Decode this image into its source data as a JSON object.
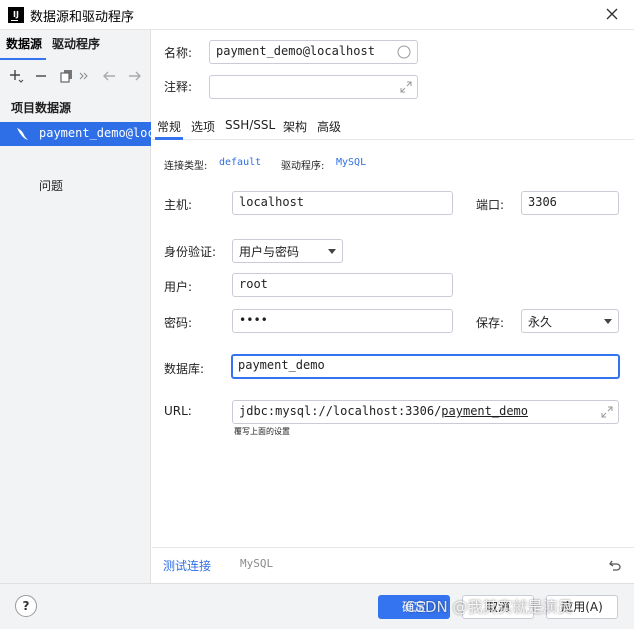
{
  "window": {
    "title": "数据源和驱动程序",
    "logo_text": "IJ"
  },
  "left": {
    "tabs": [
      "数据源",
      "驱动程序"
    ],
    "section_label": "项目数据源",
    "selected_source": "payment_demo@localhost",
    "problems_label": "问题"
  },
  "form": {
    "name_label": "名称:",
    "name_value": "payment_demo@localhost",
    "comment_label": "注释:",
    "comment_value": "",
    "tabs": [
      "常规",
      "选项",
      "SSH/SSL",
      "架构",
      "高级"
    ],
    "conn_type_label": "连接类型:",
    "conn_type_value": "default",
    "driver_label": "驱动程序:",
    "driver_value": "MySQL",
    "host_label": "主机:",
    "host_value": "localhost",
    "port_label": "端口:",
    "port_value": "3306",
    "auth_label": "身份验证:",
    "auth_value": "用户与密码",
    "user_label": "用户:",
    "user_value": "root",
    "password_label": "密码:",
    "password_value": "••••",
    "save_label": "保存:",
    "save_value": "永久",
    "database_label": "数据库:",
    "database_value": "payment_demo",
    "url_label": "URL:",
    "url_prefix": "jdbc:mysql://localhost:3306/",
    "url_db": "payment_demo",
    "url_hint": "覆写上面的设置"
  },
  "bottom": {
    "test_connection": "测试连接",
    "driver_name": "MySQL"
  },
  "footer": {
    "help": "?",
    "ok": "确定",
    "cancel": "取消",
    "apply": "应用(A)",
    "watermark": "CSDN @我其实就是演员"
  },
  "colors": {
    "accent": "#3574f0",
    "selected_bg": "#2e6ee6",
    "panel_bg": "#f2f3f5"
  }
}
